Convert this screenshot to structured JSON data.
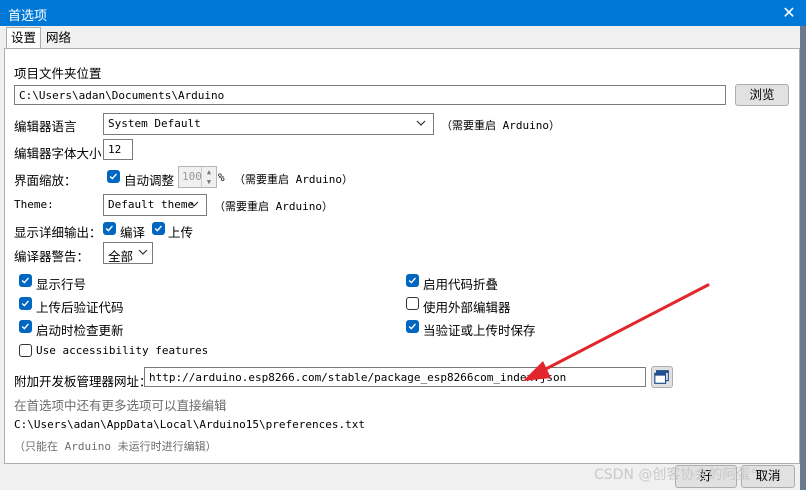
{
  "window": {
    "title": "首选项",
    "close_glyph": "✕"
  },
  "tabs": [
    {
      "label": "设置"
    },
    {
      "label": "网络"
    }
  ],
  "sketchbook": {
    "label": "项目文件夹位置",
    "path": "C:\\Users\\adan\\Documents\\Arduino",
    "browse_label": "浏览"
  },
  "editor_language": {
    "label": "编辑器语言",
    "value": "System Default",
    "note": "（需要重启 Arduino）"
  },
  "font_size": {
    "label": "编辑器字体大小",
    "value": "12"
  },
  "scale": {
    "label": "界面缩放：",
    "auto_label": "自动调整",
    "auto_checked": true,
    "value": "100",
    "unit": "%",
    "note": "（需要重启 Arduino）"
  },
  "theme": {
    "label": "Theme:",
    "value": "Default theme",
    "note": "（需要重启 Arduino）"
  },
  "verbose": {
    "label": "显示详细输出：",
    "compile_label": "编译",
    "compile_checked": true,
    "upload_label": "上传",
    "upload_checked": true
  },
  "warnings": {
    "label": "编译器警告：",
    "value": "全部"
  },
  "options_left": [
    {
      "label": "显示行号",
      "checked": true
    },
    {
      "label": "上传后验证代码",
      "checked": true
    },
    {
      "label": "启动时检查更新",
      "checked": true
    },
    {
      "label": "Use accessibility features",
      "checked": false
    }
  ],
  "options_right": [
    {
      "label": "启用代码折叠",
      "checked": true
    },
    {
      "label": "使用外部编辑器",
      "checked": false
    },
    {
      "label": "当验证或上传时保存",
      "checked": true
    }
  ],
  "board_urls": {
    "label": "附加开发板管理器网址：",
    "value": "http://arduino.esp8266.com/stable/package_esp8266com_index.json"
  },
  "more_prefs": "在首选项中还有更多选项可以直接编辑",
  "prefs_path": "C:\\Users\\adan\\AppData\\Local\\Arduino15\\preferences.txt",
  "edit_note": "（只能在 Arduino 未运行时进行编辑）",
  "buttons": {
    "ok": "好",
    "cancel": "取消"
  },
  "watermark": "CSDN @创客协会的阿蛋°",
  "colors": {
    "titlebar": "#0078d7",
    "checkbox": "#0067c0",
    "arrow": "#e3262b"
  }
}
